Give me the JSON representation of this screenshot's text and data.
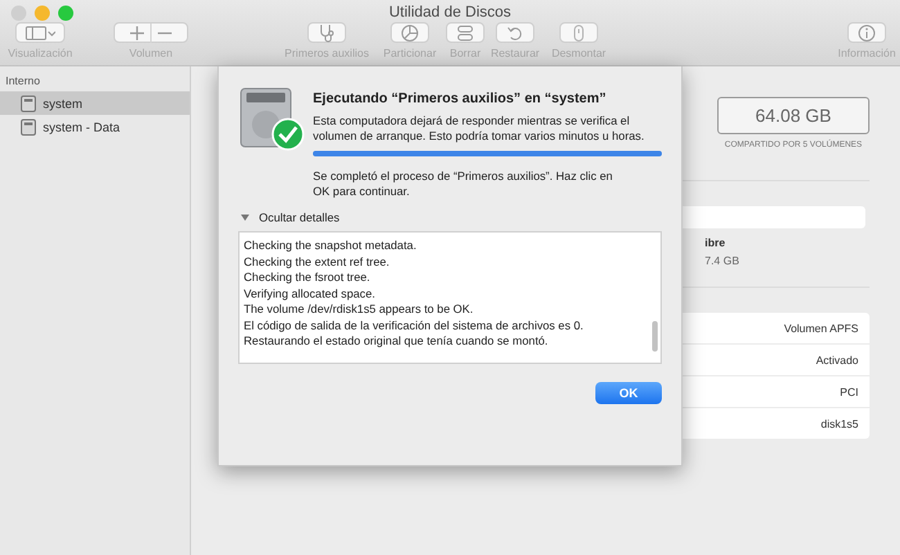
{
  "window": {
    "title": "Utilidad de Discos"
  },
  "toolbar": [
    {
      "label": "Visualización",
      "kind": "view"
    },
    {
      "label": "Volumen",
      "kind": "plusminus"
    },
    {
      "label": "Primeros auxilios",
      "kind": "firstaid"
    },
    {
      "label": "Particionar",
      "kind": "partition"
    },
    {
      "label": "Borrar",
      "kind": "erase"
    },
    {
      "label": "Restaurar",
      "kind": "restore"
    },
    {
      "label": "Desmontar",
      "kind": "unmount"
    },
    {
      "label": "Información",
      "kind": "info"
    }
  ],
  "sidebar": {
    "section": "Interno",
    "items": [
      {
        "label": "system",
        "selected": true
      },
      {
        "label": "system - Data",
        "selected": false
      }
    ]
  },
  "main": {
    "capacity": "64.08 GB",
    "capacity_note": "COMPARTIDO POR 5 VOLÚMENES",
    "free_label": "ibre",
    "free_value": "7.4 GB",
    "info_values": [
      "Volumen APFS",
      "Activado",
      "PCI",
      "disk1s5"
    ]
  },
  "sheet": {
    "title": "Ejecutando “Primeros auxilios” en “system”",
    "message": "Esta computadora dejará de responder mientras se verifica el volumen de arranque. Esto podría tomar varios minutos u horas.",
    "progress": {
      "level": 1
    },
    "result": "Se completó el proceso de “Primeros auxilios”. Haz clic en OK para continuar.",
    "details": {
      "label": "Ocultar detalles",
      "expanded": true,
      "lines": [
        "Checking the snapshot metadata.",
        "Checking the extent ref tree.",
        "Checking the fsroot tree.",
        "Verifying allocated space.",
        "The volume /dev/rdisk1s5 appears to be OK.",
        "El código de salida de la verificación del sistema de archivos es 0.",
        "Restaurando el estado original que tenía cuando se montó."
      ]
    },
    "ok": "OK"
  }
}
